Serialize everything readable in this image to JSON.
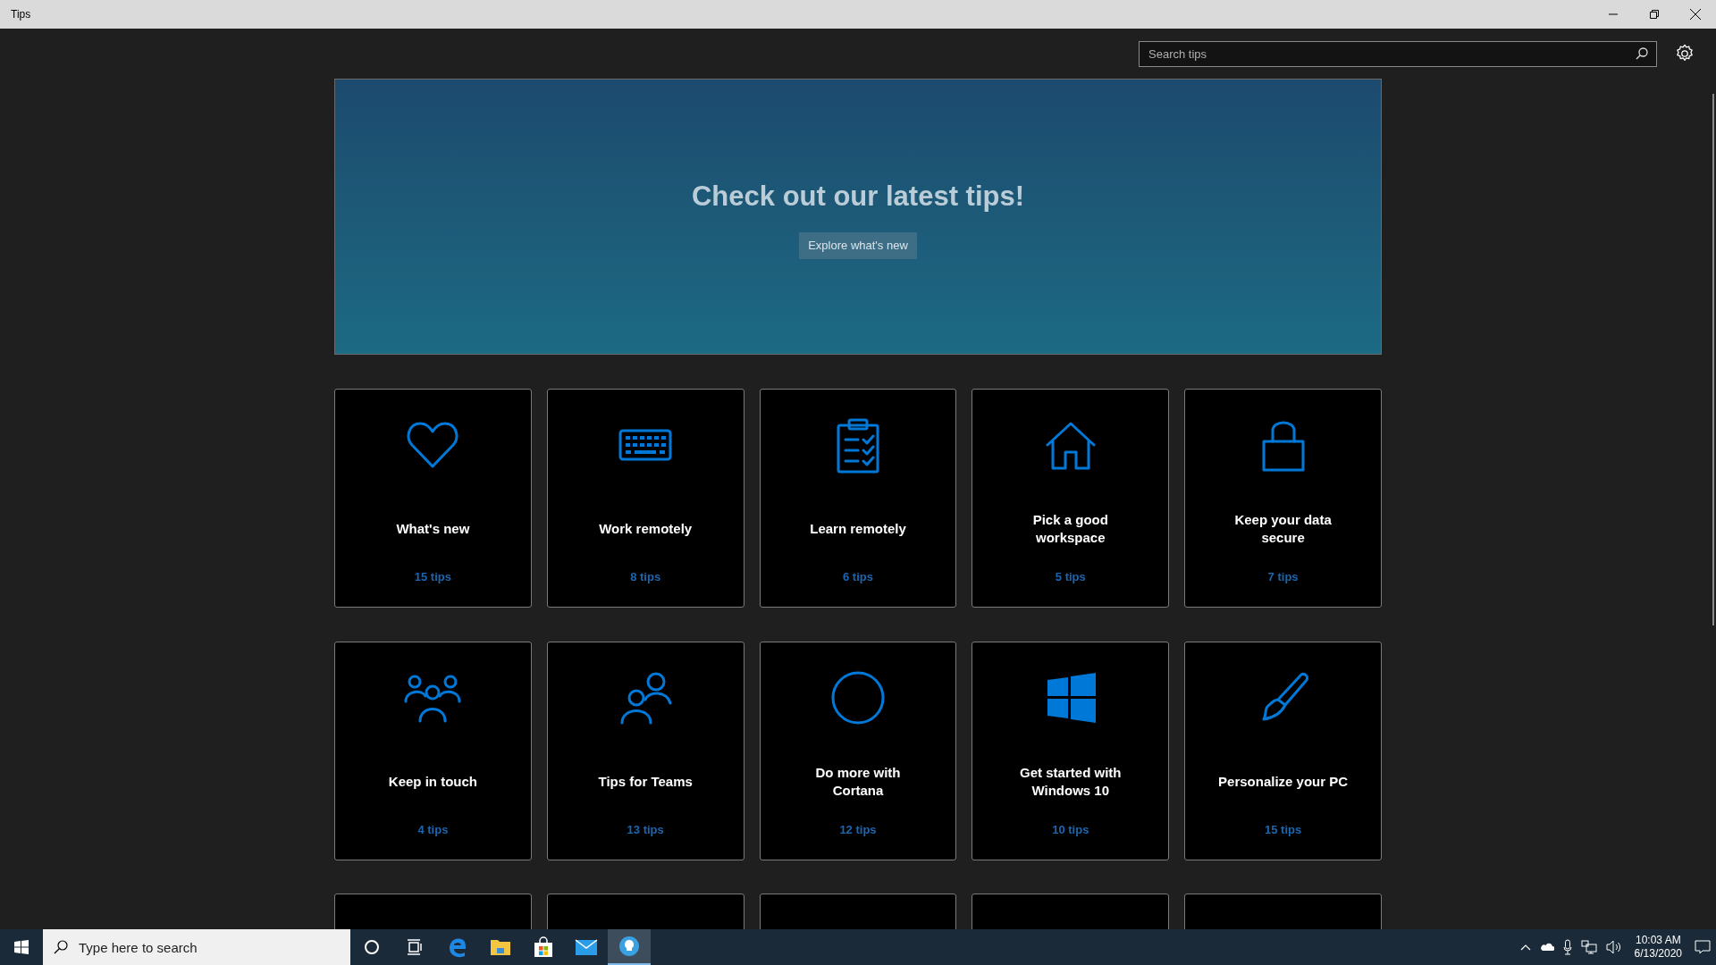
{
  "window": {
    "title": "Tips"
  },
  "search": {
    "placeholder": "Search tips"
  },
  "banner": {
    "heading": "Check out our latest tips!",
    "button": "Explore what's new"
  },
  "tile_rows": [
    [
      {
        "title": "What's new",
        "count": "15 tips"
      },
      {
        "title": "Work remotely",
        "count": "8 tips"
      },
      {
        "title": "Learn remotely",
        "count": "6 tips"
      },
      {
        "title": "Pick a good workspace",
        "count": "5 tips"
      },
      {
        "title": "Keep your data secure",
        "count": "7 tips"
      }
    ],
    [
      {
        "title": "Keep in touch",
        "count": "4 tips"
      },
      {
        "title": "Tips for Teams",
        "count": "13 tips"
      },
      {
        "title": "Do more with Cortana",
        "count": "12 tips"
      },
      {
        "title": "Get started with Windows 10",
        "count": "10 tips"
      },
      {
        "title": "Personalize your PC",
        "count": "15 tips"
      }
    ]
  ],
  "taskbar": {
    "search_placeholder": "Type here to search",
    "apps": [
      {
        "selected": false
      },
      {
        "selected": false
      },
      {
        "selected": false
      },
      {
        "selected": false
      },
      {
        "selected": false
      },
      {
        "selected": false
      },
      {
        "selected": true
      }
    ],
    "time": "10:03 AM",
    "date": "6/13/2020"
  }
}
